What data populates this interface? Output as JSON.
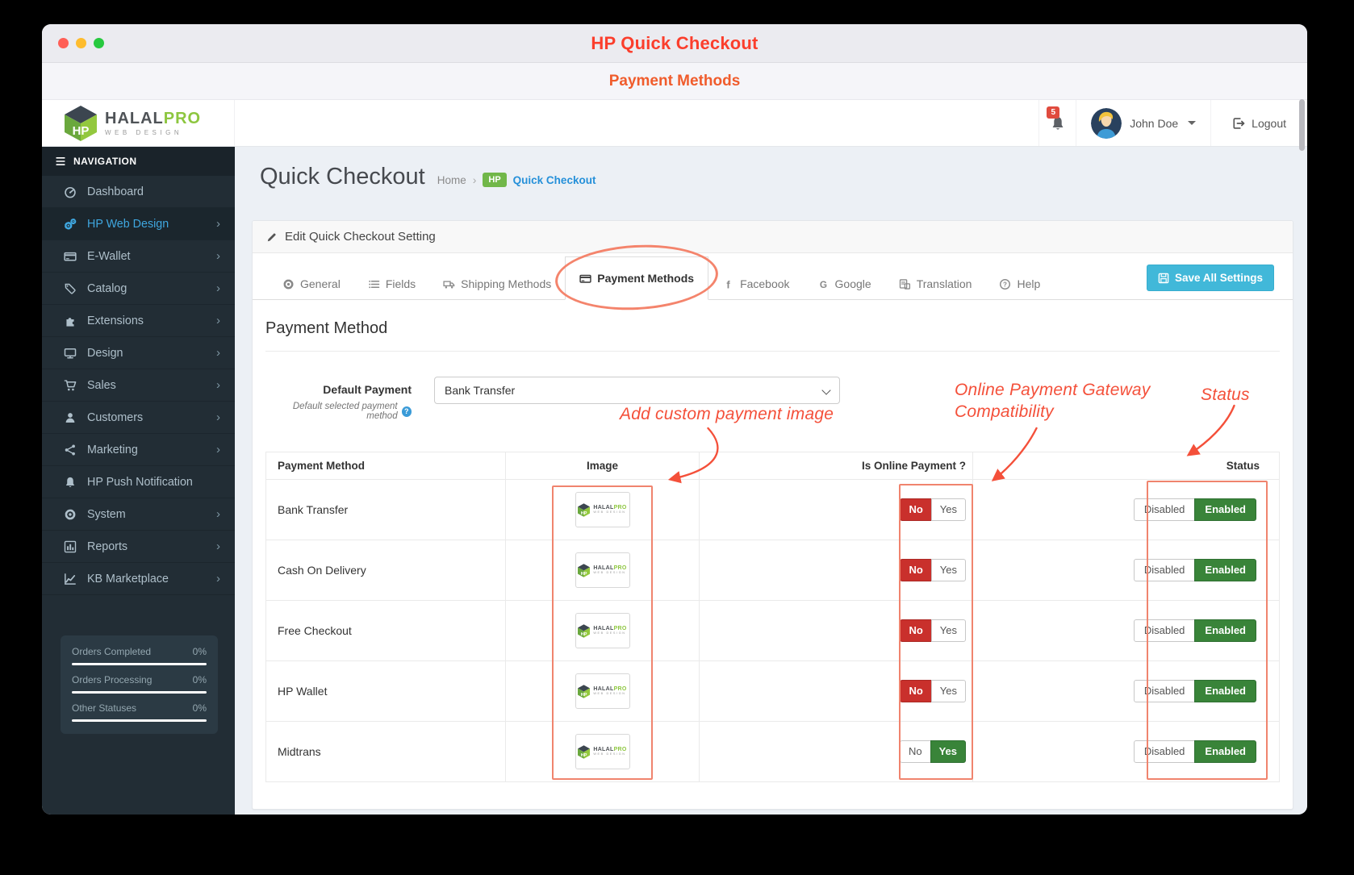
{
  "window": {
    "title": "HP Quick Checkout",
    "subtitle": "Payment Methods"
  },
  "brand": {
    "word_dark": "HALAL",
    "word_green": "PRO",
    "tagline": "WEB DESIGN",
    "cube_letters": "HP"
  },
  "header": {
    "notification_count": "5",
    "user_name": "John Doe",
    "logout_label": "Logout"
  },
  "sidebar": {
    "nav_label": "NAVIGATION",
    "items": [
      {
        "label": "Dashboard",
        "icon": "gauge-icon",
        "has_children": false,
        "active": false
      },
      {
        "label": "HP Web Design",
        "icon": "gears-icon",
        "has_children": true,
        "active": true
      },
      {
        "label": "E-Wallet",
        "icon": "credit-card-icon",
        "has_children": true,
        "active": false
      },
      {
        "label": "Catalog",
        "icon": "tags-icon",
        "has_children": true,
        "active": false
      },
      {
        "label": "Extensions",
        "icon": "puzzle-icon",
        "has_children": true,
        "active": false
      },
      {
        "label": "Design",
        "icon": "monitor-icon",
        "has_children": true,
        "active": false
      },
      {
        "label": "Sales",
        "icon": "cart-icon",
        "has_children": true,
        "active": false
      },
      {
        "label": "Customers",
        "icon": "user-icon",
        "has_children": true,
        "active": false
      },
      {
        "label": "Marketing",
        "icon": "share-icon",
        "has_children": true,
        "active": false
      },
      {
        "label": "HP Push Notification",
        "icon": "bell-icon",
        "has_children": false,
        "active": false
      },
      {
        "label": "System",
        "icon": "gear-icon",
        "has_children": true,
        "active": false
      },
      {
        "label": "Reports",
        "icon": "bar-chart-icon",
        "has_children": true,
        "active": false
      },
      {
        "label": "KB Marketplace",
        "icon": "line-chart-icon",
        "has_children": true,
        "active": false
      }
    ],
    "stats": [
      {
        "label": "Orders Completed",
        "value": "0%"
      },
      {
        "label": "Orders Processing",
        "value": "0%"
      },
      {
        "label": "Other Statuses",
        "value": "0%"
      }
    ]
  },
  "page": {
    "title": "Quick Checkout",
    "breadcrumb_home": "Home",
    "breadcrumb_sep": "›",
    "breadcrumb_badge": "HP",
    "breadcrumb_current": "Quick Checkout"
  },
  "panel": {
    "header": "Edit Quick Checkout Setting",
    "save_button": "Save All Settings",
    "tabs": [
      {
        "label": "General",
        "icon": "gear-icon",
        "active": false
      },
      {
        "label": "Fields",
        "icon": "list-icon",
        "active": false
      },
      {
        "label": "Shipping Methods",
        "icon": "truck-icon",
        "active": false
      },
      {
        "label": "Payment Methods",
        "icon": "credit-card-icon",
        "active": true
      },
      {
        "label": "Facebook",
        "icon": "facebook-icon",
        "active": false
      },
      {
        "label": "Google",
        "icon": "google-icon",
        "active": false
      },
      {
        "label": "Translation",
        "icon": "translation-icon",
        "active": false
      },
      {
        "label": "Help",
        "icon": "help-icon",
        "active": false
      }
    ]
  },
  "form": {
    "section_heading": "Payment Method",
    "default_payment_label": "Default Payment",
    "default_payment_help": "Default selected payment method",
    "default_payment_value": "Bank Transfer"
  },
  "table": {
    "headers": [
      "Payment Method",
      "Image",
      "Is Online Payment ?",
      "Status"
    ],
    "toggle_labels": {
      "no": "No",
      "yes": "Yes",
      "disabled": "Disabled",
      "enabled": "Enabled"
    },
    "rows": [
      {
        "name": "Bank Transfer",
        "is_online": "No",
        "status": "Enabled"
      },
      {
        "name": "Cash On Delivery",
        "is_online": "No",
        "status": "Enabled"
      },
      {
        "name": "Free Checkout",
        "is_online": "No",
        "status": "Enabled"
      },
      {
        "name": "HP Wallet",
        "is_online": "No",
        "status": "Enabled"
      },
      {
        "name": "Midtrans",
        "is_online": "Yes",
        "status": "Enabled"
      }
    ]
  },
  "annotations": {
    "image_note": "Add custom payment image",
    "gateway_note_line1": "Online Payment Gateway",
    "gateway_note_line2": "Compatibility",
    "status_note": "Status"
  },
  "colors": {
    "title_red": "#fb3e2c",
    "subtitle_orange": "#f05c2c",
    "annotation": "#f4503a",
    "highlight_box": "#f0846e",
    "save_button": "#41b8d9",
    "toggle_red": "#c9302c",
    "toggle_green": "#398439",
    "brand_green": "#8dc63f",
    "link_blue": "#2590d9",
    "sidebar_active": "#3fa7e0"
  }
}
